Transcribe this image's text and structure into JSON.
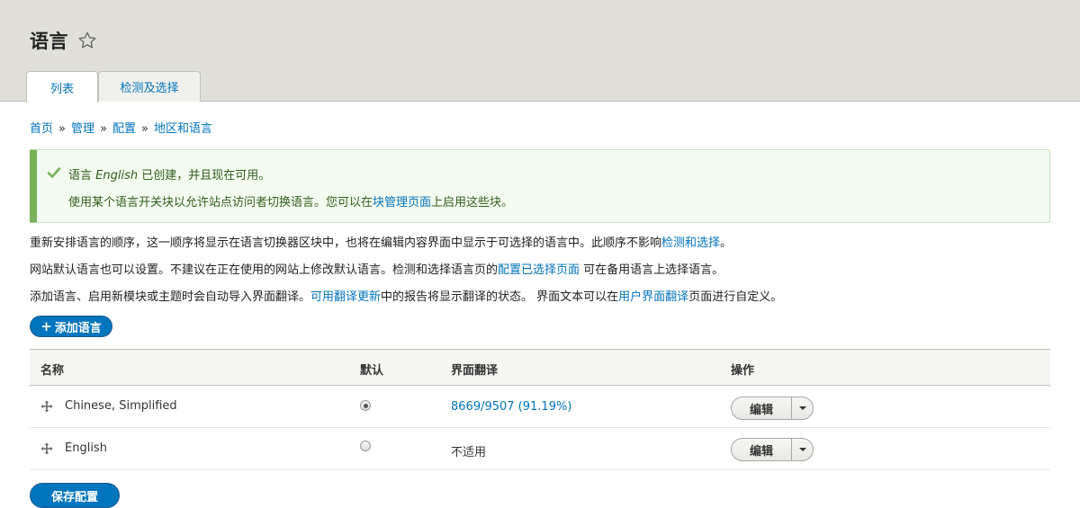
{
  "header": {
    "title": "语言",
    "tabs": [
      {
        "label": "列表",
        "active": true
      },
      {
        "label": "检测及选择",
        "active": false
      }
    ]
  },
  "breadcrumb": {
    "items": [
      "首页",
      "管理",
      "配置",
      "地区和语言"
    ],
    "separator": "»"
  },
  "status": {
    "line1_prefix": "语言 ",
    "line1_lang": "English",
    "line1_suffix": " 已创建，并且现在可用。",
    "line2_prefix": "使用某个语言开关块以允许站点访问者切换语言。您可以在",
    "line2_link": "块管理页面",
    "line2_suffix": "上启用这些块。"
  },
  "descriptions": {
    "p1_text": "重新安排语言的顺序，这一顺序将显示在语言切换器区块中，也将在编辑内容界面中显示于可选择的语言中。此顺序不影响",
    "p1_link": "检测和选择",
    "p1_end": "。",
    "p2_text": "网站默认语言也可以设置。不建议在正在使用的网站上修改默认语言。检测和选择语言页的",
    "p2_link": "配置已选择页面",
    "p2_end": " 可在备用语言上选择语言。",
    "p3_text": "添加语言、启用新模块或主题时会自动导入界面翻译。",
    "p3_link1": "可用翻译更新",
    "p3_mid": "中的报告将显示翻译的状态。 界面文本可以在",
    "p3_link2": "用户界面翻译",
    "p3_end": "页面进行自定义。"
  },
  "add_button": {
    "icon": "+",
    "label": "添加语言"
  },
  "table": {
    "headers": {
      "name": "名称",
      "default": "默认",
      "translation": "界面翻译",
      "operations": "操作"
    },
    "rows": [
      {
        "name": "Chinese, Simplified",
        "default": true,
        "translation": "8669/9507 (91.19%)",
        "translation_is_link": true,
        "edit": "编辑"
      },
      {
        "name": "English",
        "default": false,
        "translation": "不适用",
        "translation_is_link": false,
        "edit": "编辑"
      }
    ]
  },
  "save_button": {
    "label": "保存配置"
  },
  "colors": {
    "accent": "#0074bd",
    "header_bg": "#e0e0d8",
    "status_border": "#77b259",
    "status_bg": "#f3faef"
  }
}
